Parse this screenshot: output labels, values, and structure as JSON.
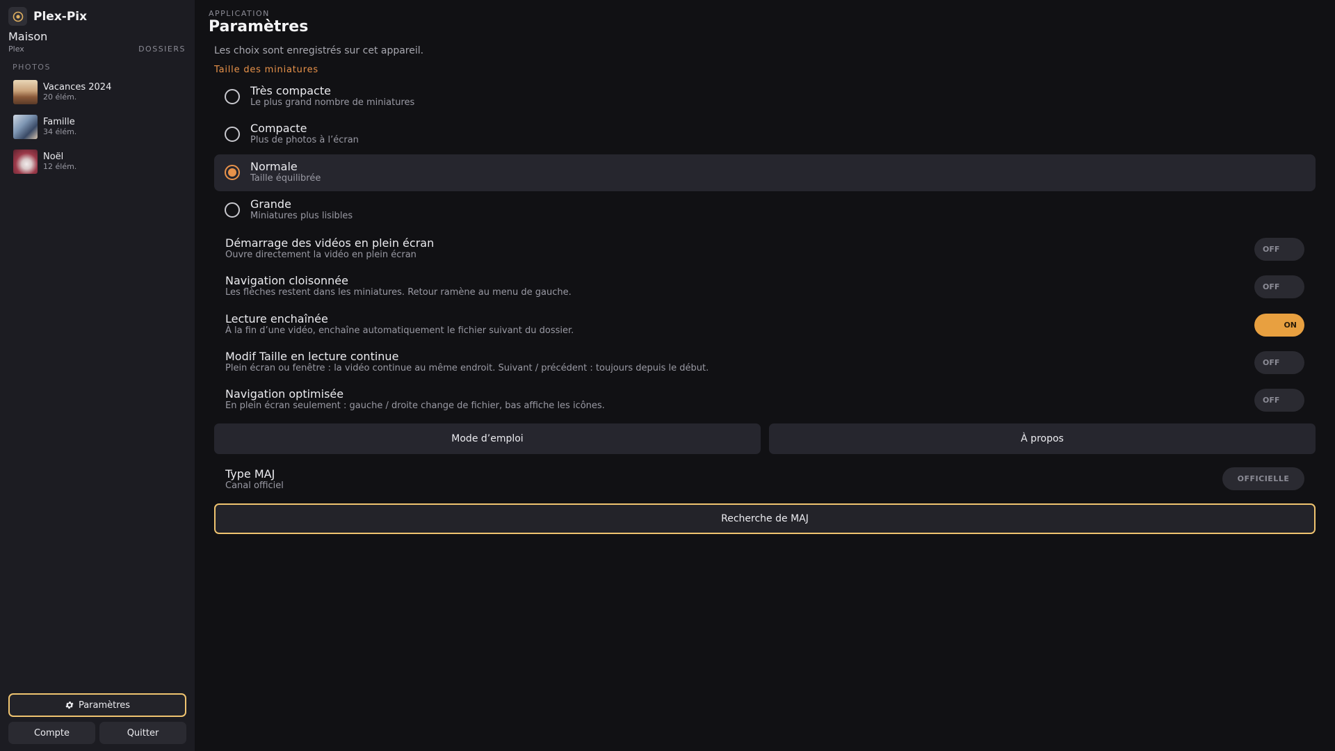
{
  "app": {
    "name": "Plex-Pix",
    "logo_icon": "aperture-icon"
  },
  "sidebar": {
    "server_name": "Maison",
    "server_type": "Plex",
    "folders_label": "DOSSIERS",
    "section_label": "PHOTOS",
    "albums": [
      {
        "name": "Vacances 2024",
        "count": "20 élém."
      },
      {
        "name": "Famille",
        "count": "34 élém."
      },
      {
        "name": "Noël",
        "count": "12 élém."
      }
    ],
    "settings_label": "Paramètres",
    "account_label": "Compte",
    "quit_label": "Quitter"
  },
  "main": {
    "eyebrow": "APPLICATION",
    "title": "Paramètres",
    "description": "Les choix sont enregistrés sur cet appareil.",
    "thumb_group_label": "Taille des miniatures",
    "thumb_options": [
      {
        "title": "Très compacte",
        "subtitle": "Le plus grand nombre de miniatures",
        "selected": false
      },
      {
        "title": "Compacte",
        "subtitle": "Plus de photos à l’écran",
        "selected": false
      },
      {
        "title": "Normale",
        "subtitle": "Taille équilibrée",
        "selected": true
      },
      {
        "title": "Grande",
        "subtitle": "Miniatures plus lisibles",
        "selected": false
      }
    ],
    "toggles": [
      {
        "title": "Démarrage des vidéos en plein écran",
        "subtitle": "Ouvre directement la vidéo en plein écran",
        "state": "OFF"
      },
      {
        "title": "Navigation cloisonnée",
        "subtitle": "Les flèches restent dans les miniatures. Retour ramène au menu de gauche.",
        "state": "OFF"
      },
      {
        "title": "Lecture enchaînée",
        "subtitle": "À la fin d’une vidéo, enchaîne automatiquement le fichier suivant du dossier.",
        "state": "ON"
      },
      {
        "title": "Modif Taille en lecture continue",
        "subtitle": "Plein écran ou fenêtre : la vidéo continue au même endroit. Suivant / précédent : toujours depuis le début.",
        "state": "OFF"
      },
      {
        "title": "Navigation optimisée",
        "subtitle": "En plein écran seulement : gauche / droite change de fichier, bas affiche les icônes.",
        "state": "OFF"
      }
    ],
    "manual_label": "Mode d’emploi",
    "about_label": "À propos",
    "update": {
      "title": "Type MAJ",
      "subtitle": "Canal officiel",
      "value": "OFFICIELLE"
    },
    "check_update_label": "Recherche de MAJ"
  },
  "colors": {
    "accent": "#e8924a",
    "focus_border": "#f0c470",
    "toggle_on": "#e8a040",
    "sidebar_bg": "#1c1c22",
    "main_bg": "#111114"
  }
}
